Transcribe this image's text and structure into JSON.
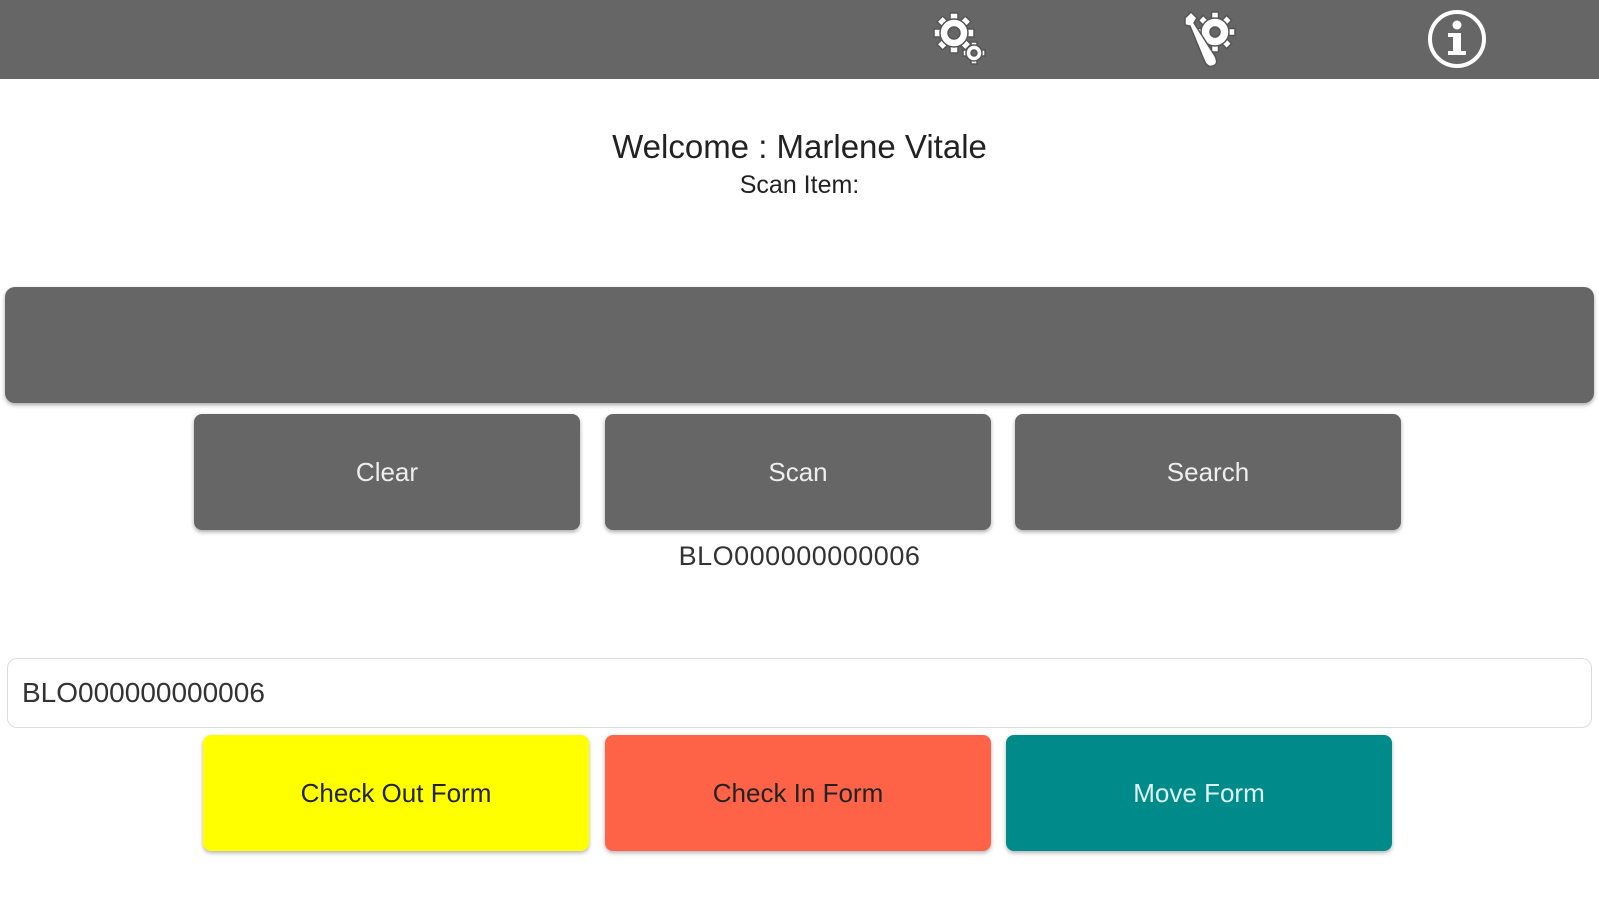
{
  "toolbar": {
    "icons": [
      "settings-gears-icon",
      "tools-gear-icon",
      "info-icon"
    ]
  },
  "header": {
    "welcome": "Welcome : Marlene Vitale",
    "scan_item_label": "Scan Item:"
  },
  "actions": {
    "clear_label": "Clear",
    "scan_label": "Scan",
    "search_label": "Search"
  },
  "scanned_code": "BLO000000000006",
  "code_input": {
    "value": "BLO000000000006"
  },
  "forms": {
    "check_out_label": "Check Out Form",
    "check_out_color": "#ffff00",
    "check_in_label": "Check In Form",
    "check_in_color": "#ff6347",
    "move_label": "Move Form",
    "move_color": "#008b8b"
  }
}
